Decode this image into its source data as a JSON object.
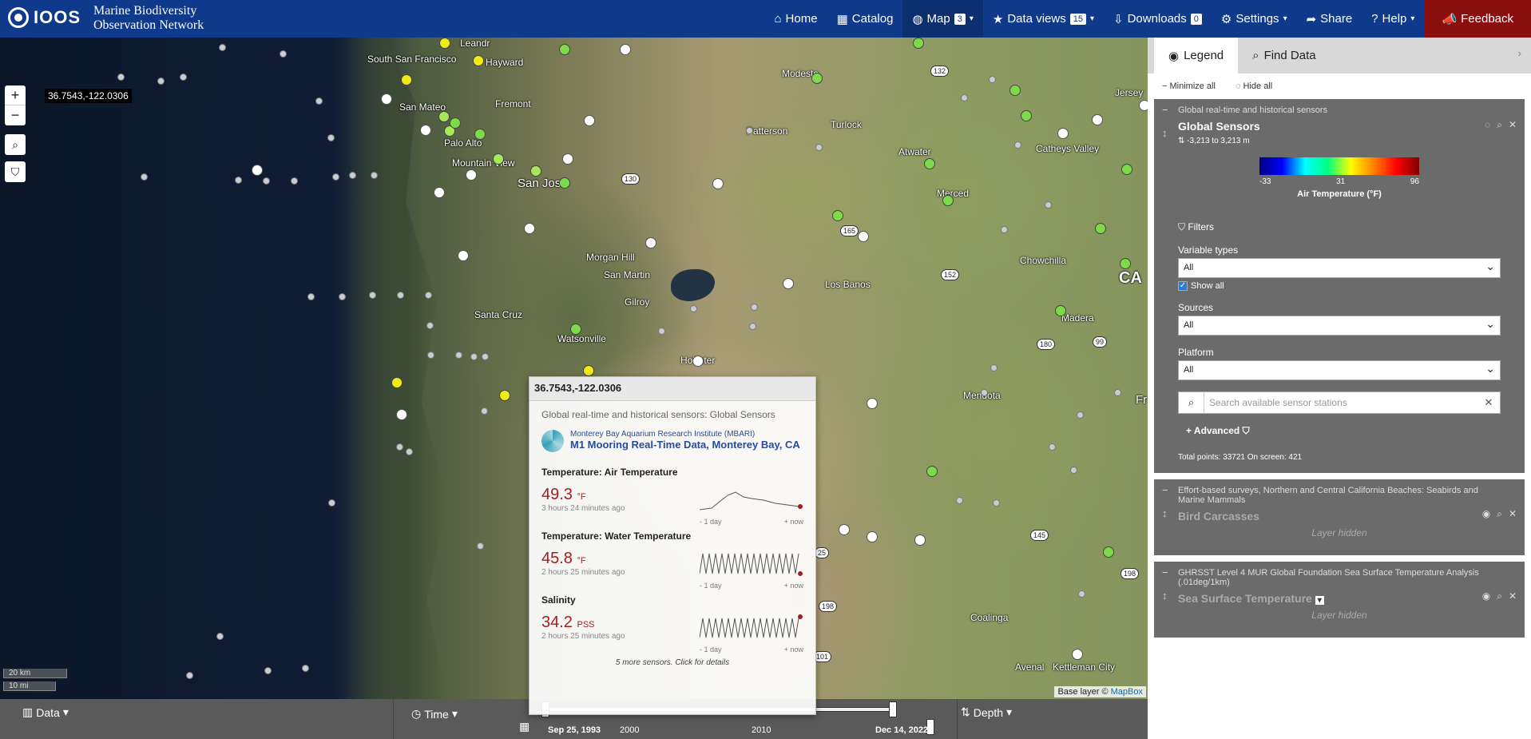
{
  "header": {
    "logo_text": "IOOS",
    "org_line1": "Marine Biodiversity",
    "org_line2": "Observation Network"
  },
  "nav": [
    {
      "icon": "⌂",
      "label": "Home"
    },
    {
      "icon": "▦",
      "label": "Catalog"
    },
    {
      "icon": "◍",
      "label": "Map",
      "badge": "3",
      "caret": "▾"
    },
    {
      "icon": "★",
      "label": "Data views",
      "badge": "15",
      "caret": "▾"
    },
    {
      "icon": "⇩",
      "label": "Downloads",
      "badge": "0"
    },
    {
      "icon": "⚙",
      "label": "Settings",
      "caret": "▾"
    },
    {
      "icon": "➦",
      "label": "Share"
    },
    {
      "icon": "?",
      "label": "Help",
      "caret": "▾"
    },
    {
      "icon": "📣",
      "label": "Feedback"
    }
  ],
  "map": {
    "coord_readout": "36.7543,-122.0306",
    "scale_km": "20 km",
    "scale_mi": "10 mi",
    "attribution_prefix": "Base layer ©",
    "attribution_link": "MapBox",
    "places": [
      "South San Francisco",
      "Hayward",
      "Fremont",
      "San Mateo",
      "Palo Alto",
      "Mountain View",
      "San Jose",
      "Modesto",
      "Turlock",
      "Patterson",
      "Atwater",
      "Merced",
      "Catheys Valley",
      "Chowchilla",
      "Madera",
      "Morgan Hill",
      "San Martin",
      "Gilroy",
      "Los Banos",
      "Santa Cruz",
      "Watsonville",
      "Hollister",
      "Mendota",
      "Coalinga",
      "Avenal",
      "Kettleman City",
      "Jersey",
      "CA",
      "Fr",
      "Leandr"
    ]
  },
  "popup": {
    "title": "36.7543,-122.0306",
    "subtitle": "Global real-time and historical sensors: Global Sensors",
    "org": "Monterey Bay Aquarium Research Institute (MBARI)",
    "station": "M1 Mooring Real-Time Data, Monterey Bay, CA",
    "measurements": [
      {
        "name": "Temperature: Air Temperature",
        "value": "49.3",
        "unit": "°F",
        "ago": "3 hours 24 minutes ago",
        "left": "- 1 day",
        "right": "+ now"
      },
      {
        "name": "Temperature: Water Temperature",
        "value": "45.8",
        "unit": "°F",
        "ago": "2 hours 25 minutes ago",
        "left": "- 1 day",
        "right": "+ now"
      },
      {
        "name": "Salinity",
        "value": "34.2",
        "unit": "PSS",
        "ago": "2 hours 25 minutes ago",
        "left": "- 1 day",
        "right": "+ now"
      }
    ],
    "more": "5 more sensors. Click for details"
  },
  "bottom": {
    "data": "Data",
    "time": "Time",
    "depth": "Depth",
    "start": "Sep 25, 1993",
    "y2000": "2000",
    "y2010": "2010",
    "end": "Dec 14, 2022"
  },
  "panel": {
    "tab_legend": "Legend",
    "tab_find": "Find Data",
    "minimize_all": "Minimize all",
    "hide_all": "Hide all",
    "layer1": {
      "category": "Global real-time and historical sensors",
      "title": "Global Sensors",
      "depth": "-3,213 to 3,213 m",
      "cb_min": "-33",
      "cb_mid": "31",
      "cb_max": "96",
      "cb_label": "Air Temperature (°F)",
      "filters": "Filters",
      "var_types": "Variable types",
      "var_val": "All",
      "show_all": "Show all",
      "sources": "Sources",
      "src_val": "All",
      "platform": "Platform",
      "plat_val": "All",
      "search_placeholder": "Search available sensor stations",
      "advanced": "Advanced",
      "totals": "Total points: 33721 On screen: 421"
    },
    "layer2": {
      "category": "Effort-based surveys, Northern and Central California Beaches: Seabirds and Marine Mammals",
      "title": "Bird Carcasses",
      "hidden": "Layer hidden"
    },
    "layer3": {
      "category": "GHRSST Level 4 MUR Global Foundation Sea Surface Temperature Analysis (.01deg/1km)",
      "title": "Sea Surface Temperature",
      "hidden": "Layer hidden"
    }
  }
}
